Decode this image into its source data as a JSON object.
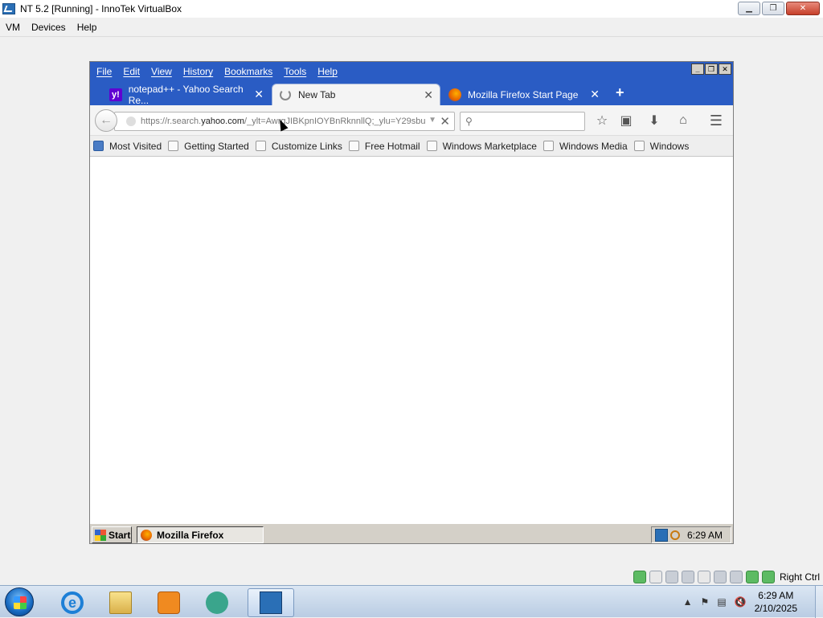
{
  "host_window": {
    "title": "NT 5.2 [Running] - InnoTek VirtualBox",
    "menu": [
      "VM",
      "Devices",
      "Help"
    ]
  },
  "firefox": {
    "menu": [
      "File",
      "Edit",
      "View",
      "History",
      "Bookmarks",
      "Tools",
      "Help"
    ],
    "tabs": [
      {
        "label": "notepad++ - Yahoo Search Re...",
        "icon": "yahoo-icon",
        "active": false
      },
      {
        "label": "New Tab",
        "icon": "loading-spinner-icon",
        "active": true
      },
      {
        "label": "Mozilla Firefox Start Page",
        "icon": "firefox-icon",
        "active": false
      }
    ],
    "url": {
      "prefix": "https://r.search.",
      "domain": "yahoo.com",
      "suffix": "/_ylt=AwrgJIBKpnIOYBnRknnllQ;_ylu=Y29sbu"
    },
    "bookmarks": [
      "Most Visited",
      "Getting Started",
      "Customize Links",
      "Free Hotmail",
      "Windows Marketplace",
      "Windows Media",
      "Windows"
    ]
  },
  "guest_taskbar": {
    "start_label": "Start",
    "task_label": "Mozilla Firefox",
    "clock": "6:29 AM"
  },
  "host_status": {
    "host_key": "Right Ctrl"
  },
  "host_taskbar": {
    "time": "6:29 AM",
    "date": "2/10/2025"
  },
  "colors": {
    "firefox_chrome_blue": "#2a5cc4",
    "yahoo_purple": "#6001d2"
  }
}
